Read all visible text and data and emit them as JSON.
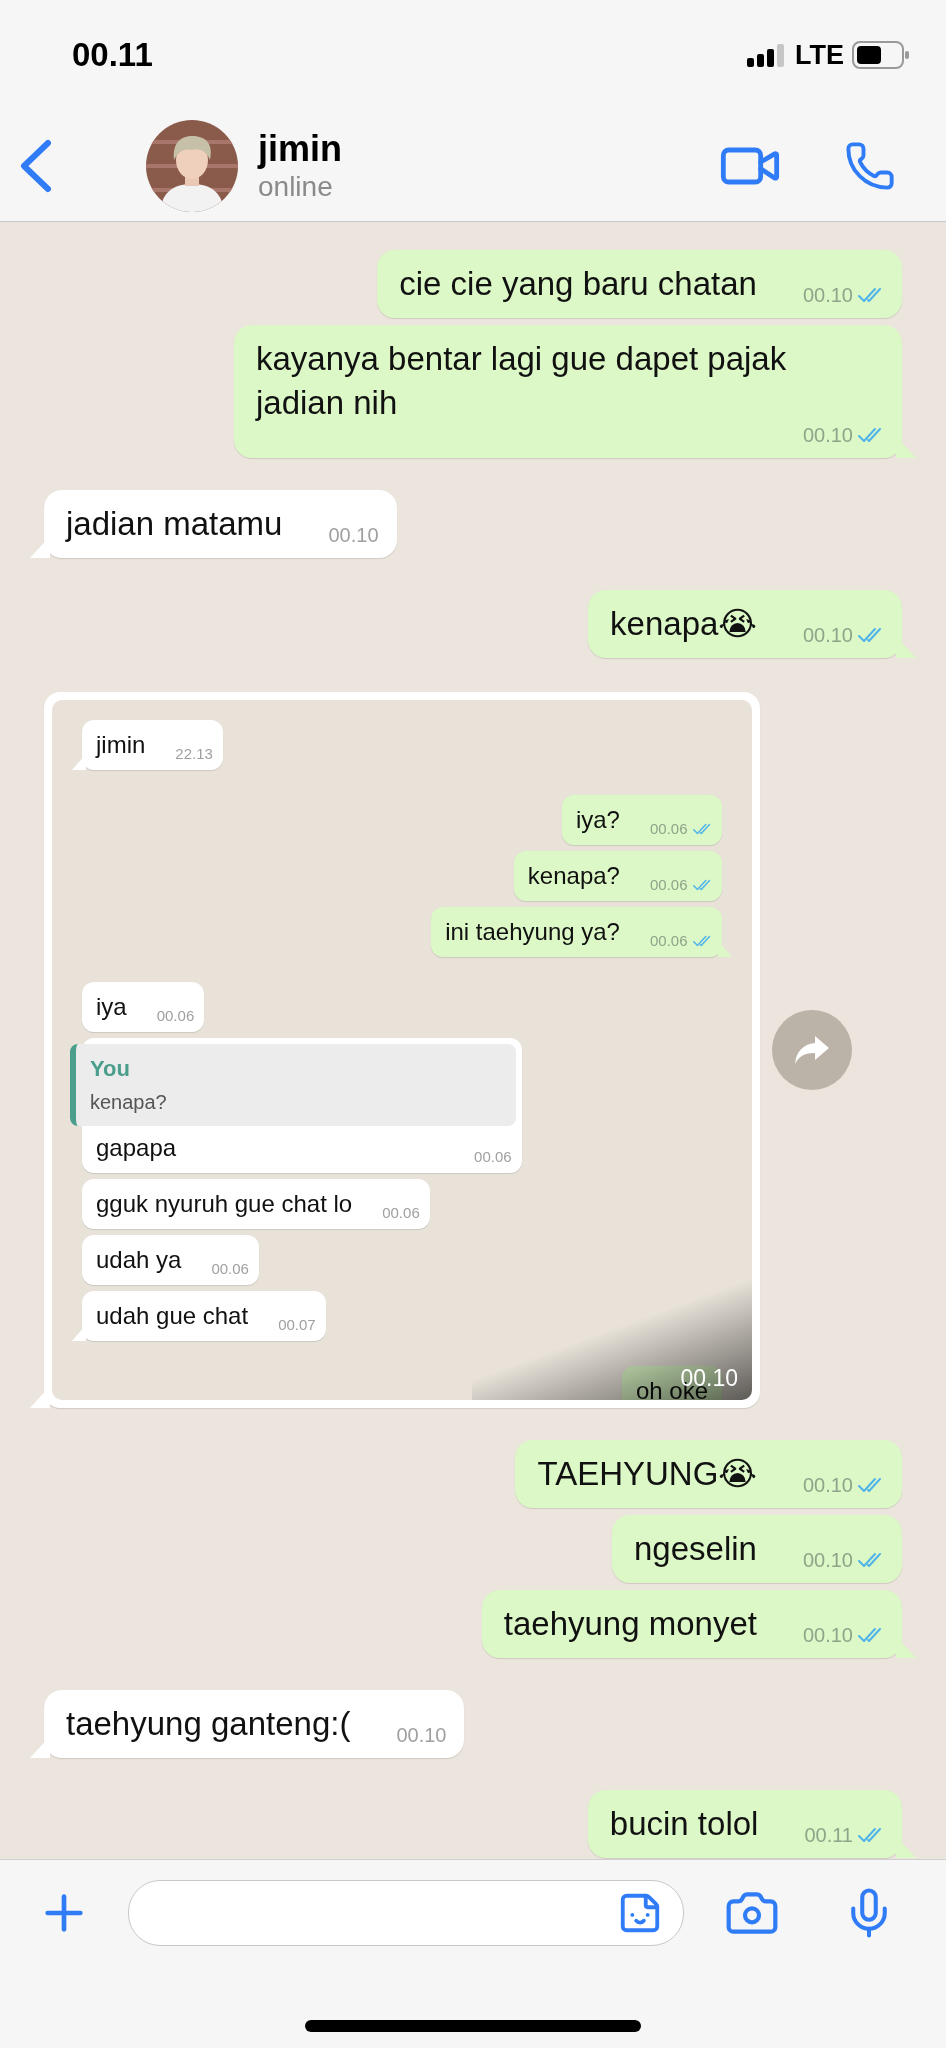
{
  "status_bar": {
    "time": "00.11",
    "network": "LTE"
  },
  "header": {
    "name": "jimin",
    "status": "online"
  },
  "messages": [
    {
      "kind": "text",
      "outgoing": true,
      "text": "cie cie yang baru chatan",
      "time": "00.10",
      "read": true,
      "tail": false
    },
    {
      "kind": "text",
      "outgoing": true,
      "text": "kayanya bentar lagi gue dapet pajak jadian nih",
      "time": "00.10",
      "read": true,
      "tail": true
    },
    {
      "kind": "text",
      "outgoing": false,
      "text": "jadian matamu",
      "time": "00.10",
      "tail": true
    },
    {
      "kind": "text",
      "outgoing": true,
      "text": "kenapa😭",
      "time": "00.10",
      "read": true,
      "tail": true
    },
    {
      "kind": "screenshot",
      "outgoing": false,
      "time": "00.10",
      "tail": true,
      "messages": [
        {
          "outgoing": false,
          "text": "jimin",
          "time": "22.13",
          "tail": true
        },
        {
          "outgoing": true,
          "text": "iya?",
          "time": "00.06",
          "read": true,
          "tail": false
        },
        {
          "outgoing": true,
          "text": "kenapa?",
          "time": "00.06",
          "read": true,
          "tail": false
        },
        {
          "outgoing": true,
          "text": "ini taehyung ya?",
          "time": "00.06",
          "read": true,
          "tail": true
        },
        {
          "outgoing": false,
          "text": "iya",
          "time": "00.06",
          "tail": false
        },
        {
          "outgoing": false,
          "quote": {
            "author": "You",
            "text": "kenapa?"
          },
          "text": "gapapa",
          "time": "00.06",
          "tail": false
        },
        {
          "outgoing": false,
          "text": "gguk nyuruh gue chat lo",
          "time": "00.06",
          "tail": false
        },
        {
          "outgoing": false,
          "text": "udah ya",
          "time": "00.06",
          "tail": false
        },
        {
          "outgoing": false,
          "text": "udah gue chat",
          "time": "00.07",
          "tail": true
        },
        {
          "outgoing": true,
          "text": "oh oke",
          "tail": false
        }
      ]
    },
    {
      "kind": "text",
      "outgoing": true,
      "text": "TAEHYUNG😭",
      "time": "00.10",
      "read": true,
      "tail": false
    },
    {
      "kind": "text",
      "outgoing": true,
      "text": "ngeselin",
      "time": "00.10",
      "read": true,
      "tail": false
    },
    {
      "kind": "text",
      "outgoing": true,
      "text": "taehyung monyet",
      "time": "00.10",
      "read": true,
      "tail": true
    },
    {
      "kind": "text",
      "outgoing": false,
      "text": "taehyung ganteng:(",
      "time": "00.10",
      "tail": true
    },
    {
      "kind": "text",
      "outgoing": true,
      "text": "bucin tolol",
      "time": "00.11",
      "read": true,
      "tail": true
    }
  ]
}
